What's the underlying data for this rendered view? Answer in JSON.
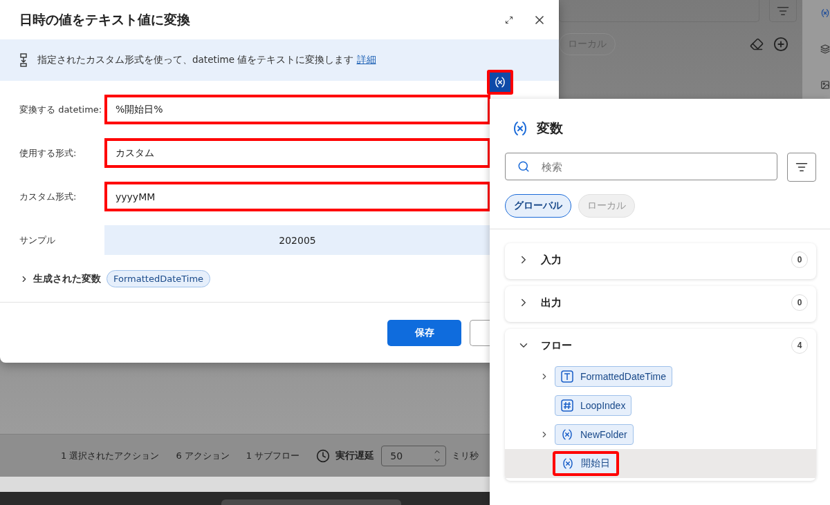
{
  "background": {
    "scope_chip": "ローカル",
    "status_bar": {
      "items": [
        "1 選択されたアクション",
        "6 アクション",
        "1 サブフロー"
      ],
      "delay_label": "実行遅延",
      "delay_value": "50",
      "delay_unit": "ミリ秒"
    }
  },
  "dialog": {
    "title": "日時の値をテキスト値に変換",
    "info": {
      "text": "指定されたカスタム形式を使って、datetime 値をテキストに変換します",
      "link": "詳細"
    },
    "fields": [
      {
        "label": "変換する datetime:",
        "value": "%開始日%",
        "kind": "input",
        "highlighted": true
      },
      {
        "label": "使用する形式:",
        "value": "カスタム",
        "kind": "select",
        "highlighted": true
      },
      {
        "label": "カスタム形式:",
        "value": "yyyyMM",
        "kind": "input",
        "highlighted": true
      },
      {
        "label": "サンプル",
        "value": "202005",
        "kind": "sample",
        "highlighted": false
      }
    ],
    "generated": {
      "label": "生成された変数",
      "expanded": false,
      "variables": [
        "FormattedDateTime"
      ]
    },
    "buttons": [
      {
        "label": "保存",
        "kind": "primary"
      },
      {
        "kind": "secondary"
      }
    ]
  },
  "variable_button": {
    "highlighted": true
  },
  "variables_panel": {
    "title": "変数",
    "search": {
      "placeholder": "検索"
    },
    "scopes": [
      {
        "label": "グローバル",
        "selected": true
      },
      {
        "label": "ローカル",
        "selected": false
      }
    ],
    "sections": [
      {
        "label": "入力",
        "count": "0",
        "expanded": false
      },
      {
        "label": "出力",
        "count": "0",
        "expanded": false
      },
      {
        "label": "フロー",
        "count": "4",
        "expanded": true,
        "items": [
          {
            "name": "FormattedDateTime",
            "kind": "text",
            "expandable": true,
            "selected": false,
            "highlighted": false
          },
          {
            "name": "LoopIndex",
            "kind": "number",
            "expandable": false,
            "selected": false,
            "highlighted": false
          },
          {
            "name": "NewFolder",
            "kind": "generic",
            "expandable": true,
            "selected": false,
            "highlighted": false
          },
          {
            "name": "開始日",
            "kind": "generic",
            "expandable": false,
            "selected": true,
            "highlighted": true
          }
        ]
      }
    ]
  }
}
